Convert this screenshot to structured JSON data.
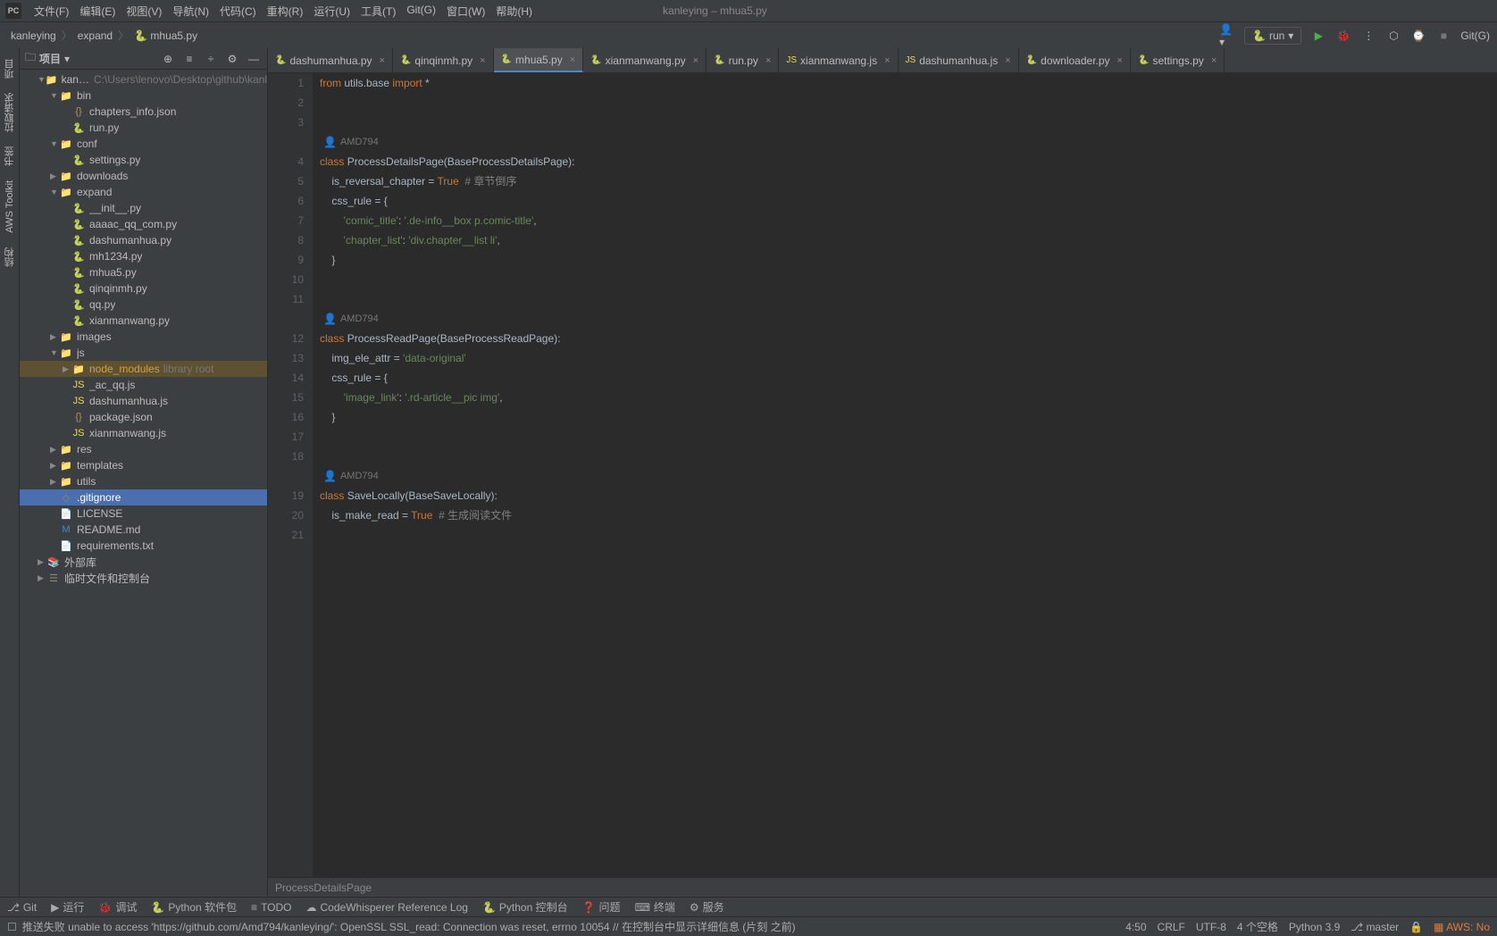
{
  "window_title": "kanleying – mhua5.py",
  "menu": [
    "文件(F)",
    "编辑(E)",
    "视图(V)",
    "导航(N)",
    "代码(C)",
    "重构(R)",
    "运行(U)",
    "工具(T)",
    "Git(G)",
    "窗口(W)",
    "帮助(H)"
  ],
  "breadcrumb": [
    "kanleying",
    "expand",
    "mhua5.py"
  ],
  "run_config": "run",
  "git_label": "Git(G)",
  "project_panel_title": "项目",
  "tree": {
    "root": {
      "name": "kanleying",
      "hint": "C:\\Users\\lenovo\\Desktop\\github\\kanl"
    },
    "items": [
      {
        "depth": 1,
        "arrow": "▼",
        "icon": "📁",
        "label": "kanleying",
        "hint": "C:\\Users\\lenovo\\Desktop\\github\\kanl"
      },
      {
        "depth": 2,
        "arrow": "▼",
        "icon": "📁",
        "label": "bin"
      },
      {
        "depth": 3,
        "arrow": "",
        "icon": "{}",
        "label": "chapters_info.json",
        "iconClass": "json-icon"
      },
      {
        "depth": 3,
        "arrow": "",
        "icon": "🐍",
        "label": "run.py",
        "iconClass": "py-icon"
      },
      {
        "depth": 2,
        "arrow": "▼",
        "icon": "📁",
        "label": "conf"
      },
      {
        "depth": 3,
        "arrow": "",
        "icon": "🐍",
        "label": "settings.py",
        "iconClass": "py-icon"
      },
      {
        "depth": 2,
        "arrow": "▶",
        "icon": "📁",
        "label": "downloads"
      },
      {
        "depth": 2,
        "arrow": "▼",
        "icon": "📁",
        "label": "expand"
      },
      {
        "depth": 3,
        "arrow": "",
        "icon": "🐍",
        "label": "__init__.py",
        "iconClass": "py-icon"
      },
      {
        "depth": 3,
        "arrow": "",
        "icon": "🐍",
        "label": "aaaac_qq_com.py",
        "iconClass": "py-icon"
      },
      {
        "depth": 3,
        "arrow": "",
        "icon": "🐍",
        "label": "dashumanhua.py",
        "iconClass": "py-icon"
      },
      {
        "depth": 3,
        "arrow": "",
        "icon": "🐍",
        "label": "mh1234.py",
        "iconClass": "py-icon"
      },
      {
        "depth": 3,
        "arrow": "",
        "icon": "🐍",
        "label": "mhua5.py",
        "iconClass": "py-icon"
      },
      {
        "depth": 3,
        "arrow": "",
        "icon": "🐍",
        "label": "qinqinmh.py",
        "iconClass": "py-icon"
      },
      {
        "depth": 3,
        "arrow": "",
        "icon": "🐍",
        "label": "qq.py",
        "iconClass": "py-icon"
      },
      {
        "depth": 3,
        "arrow": "",
        "icon": "🐍",
        "label": "xianmanwang.py",
        "iconClass": "py-icon"
      },
      {
        "depth": 2,
        "arrow": "▶",
        "icon": "📁",
        "label": "images"
      },
      {
        "depth": 2,
        "arrow": "▼",
        "icon": "📁",
        "label": "js"
      },
      {
        "depth": 3,
        "arrow": "▶",
        "icon": "📁",
        "label": "node_modules",
        "hint": "library root",
        "highlight": true
      },
      {
        "depth": 3,
        "arrow": "",
        "icon": "JS",
        "label": "_ac_qq.js",
        "iconClass": "js-icon"
      },
      {
        "depth": 3,
        "arrow": "",
        "icon": "JS",
        "label": "dashumanhua.js",
        "iconClass": "js-icon"
      },
      {
        "depth": 3,
        "arrow": "",
        "icon": "{}",
        "label": "package.json",
        "iconClass": "json-icon"
      },
      {
        "depth": 3,
        "arrow": "",
        "icon": "JS",
        "label": "xianmanwang.js",
        "iconClass": "js-icon"
      },
      {
        "depth": 2,
        "arrow": "▶",
        "icon": "📁",
        "label": "res"
      },
      {
        "depth": 2,
        "arrow": "▶",
        "icon": "📁",
        "label": "templates"
      },
      {
        "depth": 2,
        "arrow": "▶",
        "icon": "📁",
        "label": "utils"
      },
      {
        "depth": 2,
        "arrow": "",
        "icon": "◇",
        "label": ".gitignore",
        "selected": true
      },
      {
        "depth": 2,
        "arrow": "",
        "icon": "📄",
        "label": "LICENSE"
      },
      {
        "depth": 2,
        "arrow": "",
        "icon": "M",
        "label": "README.md",
        "iconClass": "md-icon"
      },
      {
        "depth": 2,
        "arrow": "",
        "icon": "📄",
        "label": "requirements.txt"
      },
      {
        "depth": 1,
        "arrow": "▶",
        "icon": "📚",
        "label": "外部库"
      },
      {
        "depth": 1,
        "arrow": "▶",
        "icon": "☰",
        "label": "临时文件和控制台"
      }
    ]
  },
  "tabs": [
    {
      "label": "dashumanhua.py",
      "icon": "py"
    },
    {
      "label": "qinqinmh.py",
      "icon": "py"
    },
    {
      "label": "mhua5.py",
      "icon": "py",
      "active": true
    },
    {
      "label": "xianmanwang.py",
      "icon": "py"
    },
    {
      "label": "run.py",
      "icon": "py"
    },
    {
      "label": "xianmanwang.js",
      "icon": "js"
    },
    {
      "label": "dashumanhua.js",
      "icon": "js"
    },
    {
      "label": "downloader.py",
      "icon": "py"
    },
    {
      "label": "settings.py",
      "icon": "py"
    }
  ],
  "code": {
    "line_numbers": [
      "1",
      "2",
      "3",
      "",
      "4",
      "5",
      "6",
      "7",
      "8",
      "9",
      "10",
      "11",
      "",
      "12",
      "13",
      "14",
      "15",
      "16",
      "17",
      "18",
      "",
      "19",
      "20",
      "21"
    ],
    "annotation_author": "AMD794",
    "lines": [
      {
        "n": "1",
        "html": "<span class='kw'>from</span><span class='txt'> utils.base </span><span class='kw'>import</span><span class='txt'> *</span>"
      },
      {
        "n": "2",
        "html": ""
      },
      {
        "n": "3",
        "html": ""
      },
      {
        "annotation": "AMD794"
      },
      {
        "n": "4",
        "html": "<span class='kw'>class</span><span class='txt'> </span><span class='cls'>ProcessDetailsPage</span><span class='txt'>(BaseProcessDetailsPage):</span>"
      },
      {
        "n": "5",
        "html": "<span class='txt'>    is_reversal_chapter = </span><span class='kw'>True  </span><span class='cm'># 章节倒序</span>",
        "marker": true
      },
      {
        "n": "6",
        "html": "<span class='txt'>    css_rule = {</span>",
        "marker": true
      },
      {
        "n": "7",
        "html": "<span class='txt'>        </span><span class='str'>'comic_title'</span><span class='txt'>: </span><span class='str'>'.de-info__box p.comic-title'</span><span class='txt'>,</span>"
      },
      {
        "n": "8",
        "html": "<span class='txt'>        </span><span class='str'>'chapter_list'</span><span class='txt'>: </span><span class='str'>'div.chapter__list li'</span><span class='txt'>,</span>"
      },
      {
        "n": "9",
        "html": "<span class='txt'>    }</span>"
      },
      {
        "n": "10",
        "html": ""
      },
      {
        "n": "11",
        "html": ""
      },
      {
        "annotation": "AMD794"
      },
      {
        "n": "12",
        "html": "<span class='kw'>class</span><span class='txt'> </span><span class='cls'>ProcessReadPage</span><span class='txt'>(BaseProcessReadPage):</span>"
      },
      {
        "n": "13",
        "html": "<span class='txt'>    img_ele_attr = </span><span class='str'>'data-original'</span>",
        "marker": true
      },
      {
        "n": "14",
        "html": "<span class='txt'>    css_rule = {</span>",
        "marker": true
      },
      {
        "n": "15",
        "html": "<span class='txt'>        </span><span class='str'>'image_link'</span><span class='txt'>: </span><span class='str'>'.rd-article__pic img'</span><span class='txt'>,</span>"
      },
      {
        "n": "16",
        "html": "<span class='txt'>    }</span>"
      },
      {
        "n": "17",
        "html": ""
      },
      {
        "n": "18",
        "html": ""
      },
      {
        "annotation": "AMD794"
      },
      {
        "n": "19",
        "html": "<span class='kw'>class</span><span class='txt'> </span><span class='cls'>SaveLocally</span><span class='txt'>(BaseSaveLocally):</span>"
      },
      {
        "n": "20",
        "html": "<span class='txt'>    is_make_read = </span><span class='kw'>True  </span><span class='cm'># 生成阅读文件</span>",
        "marker": true
      },
      {
        "n": "21",
        "html": ""
      }
    ]
  },
  "editor_breadcrumb": "ProcessDetailsPage",
  "left_tools": [
    "项目",
    "拉取请求",
    "书签",
    "AWS Toolkit",
    "结构"
  ],
  "bottom_tools": [
    {
      "icon": "⎇",
      "label": "Git"
    },
    {
      "icon": "▶",
      "label": "运行"
    },
    {
      "icon": "🐞",
      "label": "调试"
    },
    {
      "icon": "🐍",
      "label": "Python 软件包"
    },
    {
      "icon": "≡",
      "label": "TODO"
    },
    {
      "icon": "☁",
      "label": "CodeWhisperer Reference Log"
    },
    {
      "icon": "🐍",
      "label": "Python 控制台"
    },
    {
      "icon": "❓",
      "label": "问题"
    },
    {
      "icon": "⌨",
      "label": "终端"
    },
    {
      "icon": "⚙",
      "label": "服务"
    }
  ],
  "status": {
    "left_icon": "☐",
    "left_msg": "推送失败 unable to access 'https://github.com/Amd794/kanleying/': OpenSSL SSL_read: Connection was reset, errno 10054 // 在控制台中显示详细信息  (片刻 之前)",
    "cursor": "4:50",
    "lineend": "CRLF",
    "encoding": "UTF-8",
    "indent": "4 个空格",
    "python": "Python 3.9",
    "branch": "master",
    "aws": "AWS: No"
  }
}
